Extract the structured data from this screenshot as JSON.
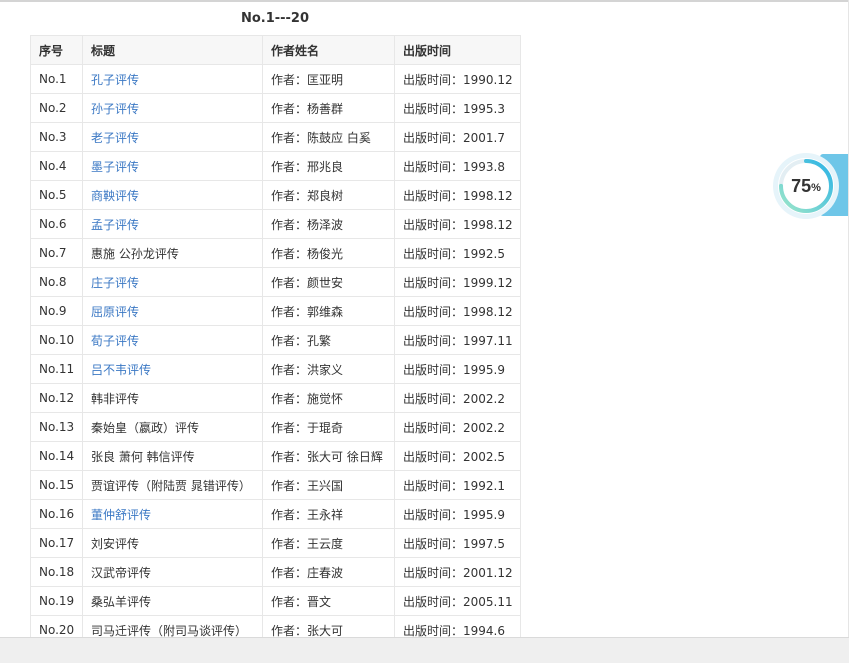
{
  "table_title": "No.1---20",
  "columns": [
    "序号",
    "标题",
    "作者姓名",
    "出版时间"
  ],
  "rows": [
    {
      "no": "No.1",
      "title": "孔子评传",
      "linked": true,
      "author": "作者：匡亚明",
      "date": "出版时间：1990.12"
    },
    {
      "no": "No.2",
      "title": "孙子评传",
      "linked": true,
      "author": "作者：杨善群",
      "date": "出版时间：1995.3"
    },
    {
      "no": "No.3",
      "title": "老子评传",
      "linked": true,
      "author": "作者：陈鼓应 白奚",
      "date": "出版时间：2001.7"
    },
    {
      "no": "No.4",
      "title": "墨子评传",
      "linked": true,
      "author": "作者：邢兆良",
      "date": "出版时间：1993.8"
    },
    {
      "no": "No.5",
      "title": "商鞅评传",
      "linked": true,
      "author": "作者：郑良树",
      "date": "出版时间：1998.12"
    },
    {
      "no": "No.6",
      "title": "孟子评传",
      "linked": true,
      "author": "作者：杨泽波",
      "date": "出版时间：1998.12"
    },
    {
      "no": "No.7",
      "title": "惠施 公孙龙评传",
      "linked": false,
      "author": "作者：杨俊光",
      "date": "出版时间：1992.5"
    },
    {
      "no": "No.8",
      "title": "庄子评传",
      "linked": true,
      "author": "作者：颜世安",
      "date": "出版时间：1999.12"
    },
    {
      "no": "No.9",
      "title": "屈原评传",
      "linked": true,
      "author": "作者：郭维森",
      "date": "出版时间：1998.12"
    },
    {
      "no": "No.10",
      "title": "荀子评传",
      "linked": true,
      "author": "作者：孔繁",
      "date": "出版时间：1997.11"
    },
    {
      "no": "No.11",
      "title": "吕不韦评传",
      "linked": true,
      "author": "作者：洪家义",
      "date": "出版时间：1995.9"
    },
    {
      "no": "No.12",
      "title": "韩非评传",
      "linked": false,
      "author": "作者：施觉怀",
      "date": "出版时间：2002.2"
    },
    {
      "no": "No.13",
      "title": "秦始皇（嬴政）评传",
      "linked": false,
      "author": "作者：于琨奇",
      "date": "出版时间：2002.2"
    },
    {
      "no": "No.14",
      "title": "张良 萧何 韩信评传",
      "linked": false,
      "author": "作者：张大可 徐日辉",
      "date": "出版时间：2002.5"
    },
    {
      "no": "No.15",
      "title": "贾谊评传（附陆贾 晁错评传）",
      "linked": false,
      "author": "作者：王兴国",
      "date": "出版时间：1992.1"
    },
    {
      "no": "No.16",
      "title": "董仲舒评传",
      "linked": true,
      "author": "作者：王永祥",
      "date": "出版时间：1995.9"
    },
    {
      "no": "No.17",
      "title": "刘安评传",
      "linked": false,
      "author": "作者：王云度",
      "date": "出版时间：1997.5"
    },
    {
      "no": "No.18",
      "title": "汉武帝评传",
      "linked": false,
      "author": "作者：庄春波",
      "date": "出版时间：2001.12"
    },
    {
      "no": "No.19",
      "title": "桑弘羊评传",
      "linked": false,
      "author": "作者：晋文",
      "date": "出版时间：2005.11"
    },
    {
      "no": "No.20",
      "title": "司马迁评传（附司马谈评传）",
      "linked": false,
      "author": "作者：张大可",
      "date": "出版时间：1994.6"
    }
  ],
  "progress": {
    "value": 0.75,
    "number": "75",
    "unit": "%"
  },
  "colors": {
    "link": "#3b78c4",
    "text": "#333333",
    "ring": "#3fb8e0",
    "side_tab": "#6ec6e8"
  },
  "icons": [
    "progress-ring-icon"
  ]
}
